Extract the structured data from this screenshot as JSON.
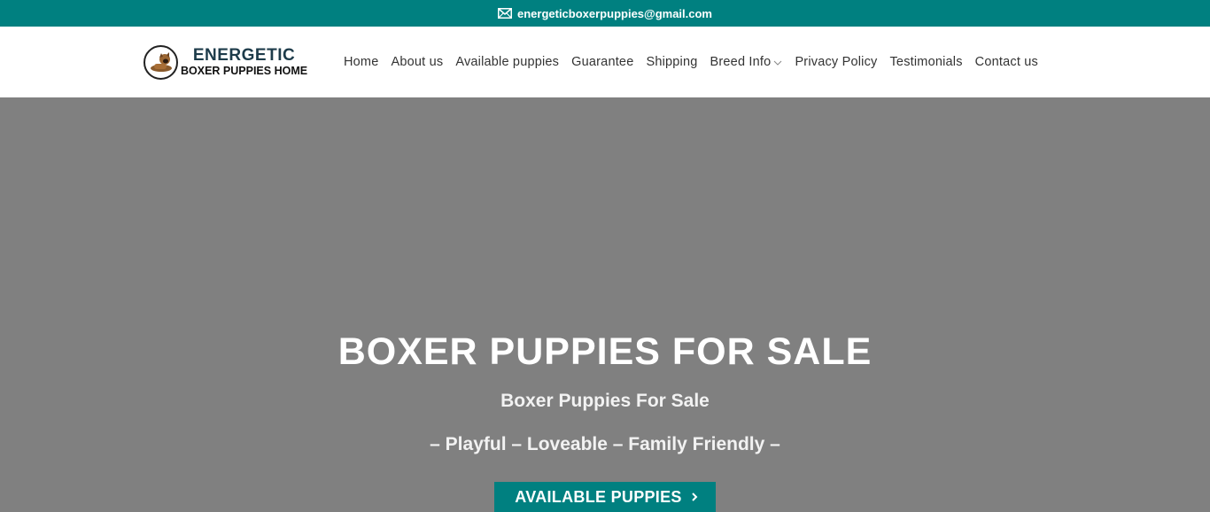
{
  "topbar": {
    "email": "energeticboxerpuppies@gmail.com",
    "icon": "mail-icon",
    "bg_color": "#008080"
  },
  "logo": {
    "line1": "ENERGETIC",
    "line2": "BOXER PUPPIES HOME"
  },
  "nav": {
    "items": [
      {
        "label": "Home"
      },
      {
        "label": "About us"
      },
      {
        "label": "Available puppies"
      },
      {
        "label": "Guarantee"
      },
      {
        "label": "Shipping"
      },
      {
        "label": "Breed Info",
        "has_dropdown": true
      },
      {
        "label": "Privacy Policy"
      },
      {
        "label": "Testimonials"
      },
      {
        "label": "Contact us"
      }
    ]
  },
  "hero": {
    "title": "BOXER PUPPIES FOR SALE",
    "subtitle": "Boxer Puppies For Sale",
    "tagline": "– Playful – Loveable – Family Friendly –",
    "button_label": "AVAILABLE PUPPIES",
    "bg_color": "#808080"
  }
}
